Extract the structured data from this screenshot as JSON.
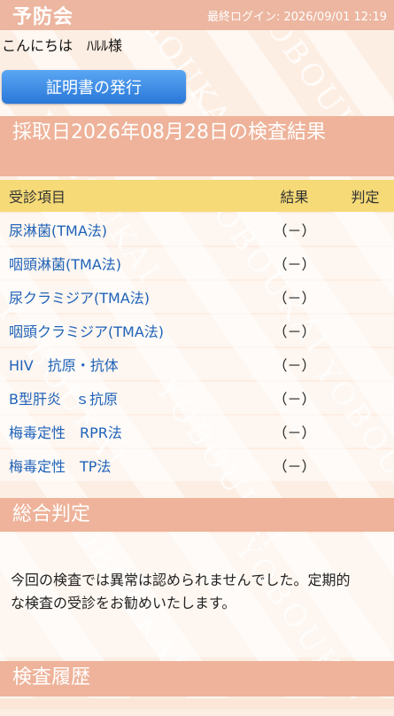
{
  "header": {
    "app_title": "予防会",
    "last_login": "最終ログイン: 2026/09/01 12:19"
  },
  "greeting": "こんにちは　ﾊﾙﾙ様",
  "certificate_button": "証明書の発行",
  "results": {
    "title": "採取日2026年08月28日の検査結果",
    "columns": {
      "item": "受診項目",
      "result": "結果",
      "judgement": "判定"
    },
    "rows": [
      {
        "item": "尿淋菌(TMA法)",
        "result": "（－）",
        "judgement": ""
      },
      {
        "item": "咽頭淋菌(TMA法)",
        "result": "（－）",
        "judgement": ""
      },
      {
        "item": "尿クラミジア(TMA法)",
        "result": "（－）",
        "judgement": ""
      },
      {
        "item": "咽頭クラミジア(TMA法)",
        "result": "（－）",
        "judgement": ""
      },
      {
        "item": "HIV　抗原・抗体",
        "result": "（－）",
        "judgement": ""
      },
      {
        "item": "B型肝炎　ｓ抗原",
        "result": "（－）",
        "judgement": ""
      },
      {
        "item": "梅毒定性　RPR法",
        "result": "（－）",
        "judgement": ""
      },
      {
        "item": "梅毒定性　TP法",
        "result": "（－）",
        "judgement": ""
      }
    ]
  },
  "overall": {
    "title": "総合判定",
    "text": "今回の検査では異常は認められませんでした。定期的な検査の受診をお勧めいたします。"
  },
  "history": {
    "title": "検査履歴"
  },
  "watermark_text": "YOBOUKAI",
  "colors": {
    "header_bg": "#ecb6a0",
    "section_bg": "#eeb39a",
    "table_head_bg": "#f5da77",
    "button": "#2a78d8",
    "link_text": "#1f62b8"
  }
}
